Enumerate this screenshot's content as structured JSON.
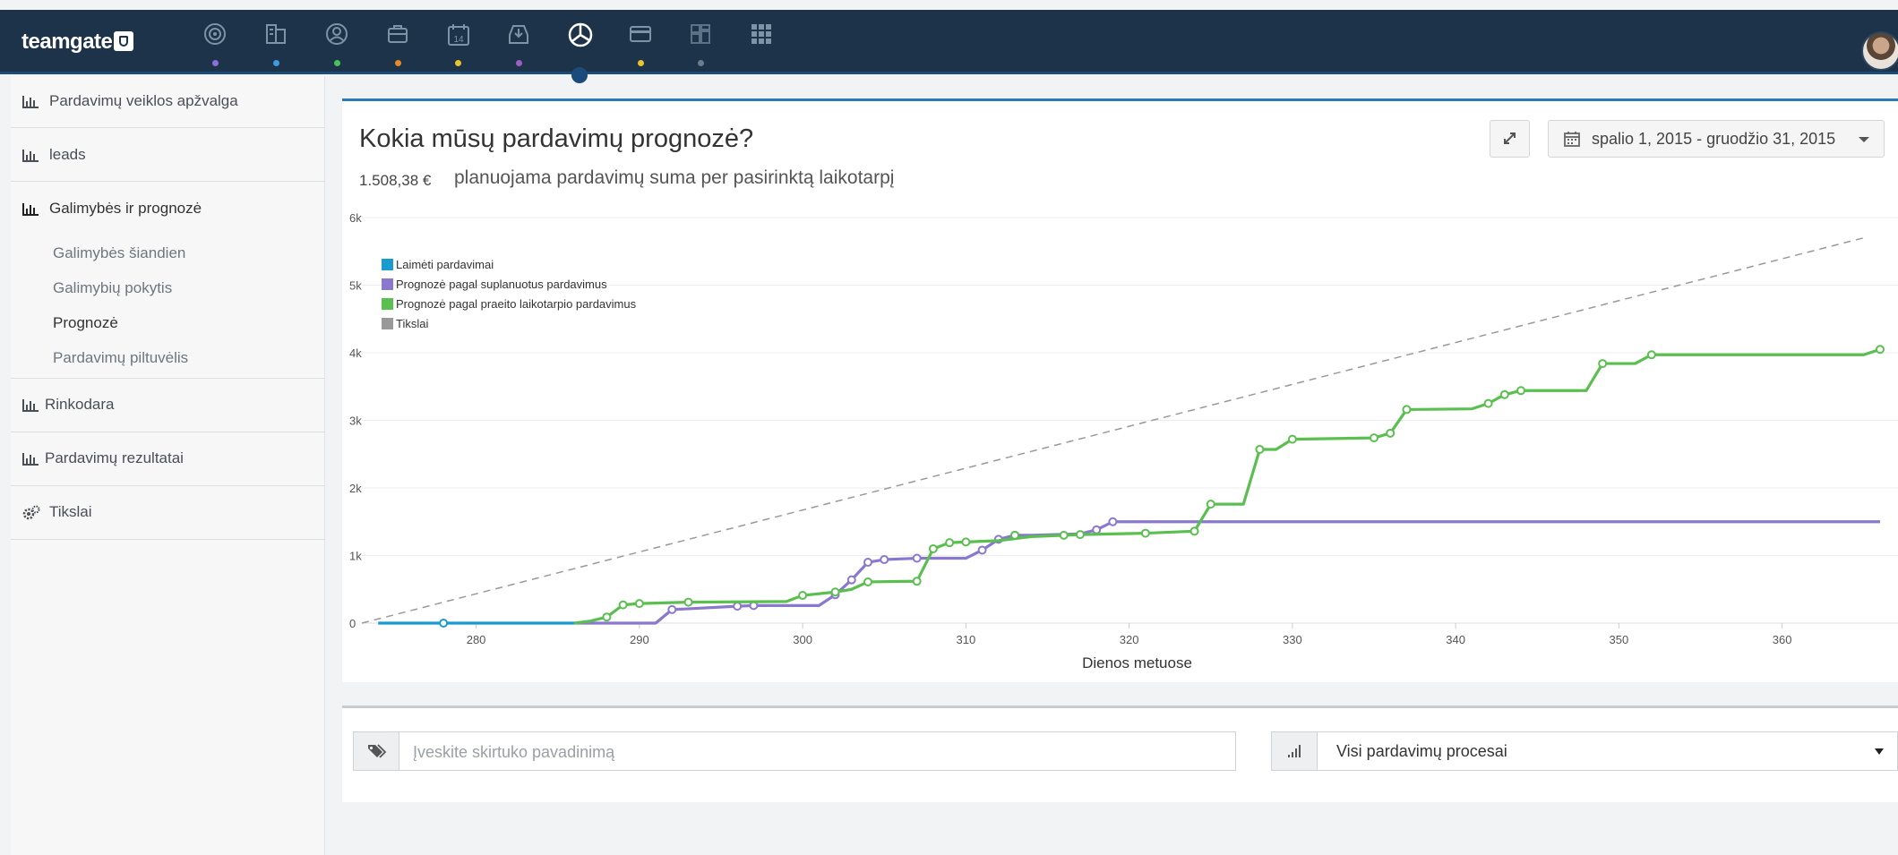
{
  "app": {
    "logo": "teamgate"
  },
  "nav": {
    "icons": [
      {
        "name": "target-icon",
        "dot_color": "#8b6fd6"
      },
      {
        "name": "building-icon",
        "dot_color": "#3d9be0"
      },
      {
        "name": "contacts-icon",
        "dot_color": "#4cc15a"
      },
      {
        "name": "briefcase-icon",
        "dot_color": "#e58a2c"
      },
      {
        "name": "calendar-icon",
        "dot_color": "#e8c32c"
      },
      {
        "name": "inbox-icon",
        "dot_color": "#9c5fc2"
      },
      {
        "name": "chart-pie-icon",
        "dot_color": "#1b4b7a"
      },
      {
        "name": "credit-card-icon",
        "dot_color": "#e8c32c"
      },
      {
        "name": "dashboard-icon",
        "dot_color": "#6b7c8c"
      },
      {
        "name": "apps-grid-icon",
        "dot_color": ""
      }
    ],
    "active_index": 6
  },
  "sidebar": {
    "sections": [
      {
        "label": "Pardavimų veiklos apžvalga"
      },
      {
        "label": "leads"
      },
      {
        "label": "Galimybės ir prognozė"
      },
      {
        "label": "Rinkodara"
      },
      {
        "label": "Pardavimų rezultatai"
      },
      {
        "label": "Tikslai"
      }
    ],
    "subitems": [
      {
        "label": "Galimybės šiandien"
      },
      {
        "label": "Galimybių pokytis"
      },
      {
        "label": "Prognozė"
      },
      {
        "label": "Pardavimų piltuvėlis"
      }
    ],
    "active_subitem": 2
  },
  "main": {
    "title": "Kokia mūsų pardavimų prognozė?",
    "sum_amount": "1.508,38 €",
    "sum_text": "planuojama pardavimų suma per pasirinktą laikotarpį",
    "date_range": "spalio 1, 2015 - gruodžio 31, 2015"
  },
  "filters": {
    "tab_placeholder": "Įveskite skirtuko pavadinimą",
    "process_select": "Visi pardavimų procesai"
  },
  "chart_data": {
    "type": "line",
    "xlabel": "Dienos metuose",
    "x_ticks": [
      280,
      290,
      300,
      310,
      320,
      330,
      340,
      350,
      360
    ],
    "y_ticks": [
      "0",
      "1k",
      "2k",
      "3k",
      "4k",
      "5k",
      "6k"
    ],
    "xlim": [
      273,
      366
    ],
    "ylim": [
      0,
      6000
    ],
    "legend_position": "top-left",
    "grid": true,
    "series": [
      {
        "name": "Laimėti pardavimai",
        "color": "#1a9bd0",
        "step": true,
        "points": [
          [
            274,
            0
          ],
          [
            278,
            0
          ],
          [
            286,
            0
          ]
        ],
        "markers": [
          [
            278,
            0
          ]
        ]
      },
      {
        "name": "Prognozė pagal suplanuotus pardavimus",
        "color": "#8a78cf",
        "step": true,
        "points": [
          [
            286,
            0
          ],
          [
            291,
            0
          ],
          [
            292,
            200
          ],
          [
            296,
            250
          ],
          [
            297,
            260
          ],
          [
            301,
            260
          ],
          [
            302,
            420
          ],
          [
            303,
            640
          ],
          [
            304,
            900
          ],
          [
            305,
            940
          ],
          [
            307,
            960
          ],
          [
            310,
            960
          ],
          [
            311,
            1080
          ],
          [
            312,
            1240
          ],
          [
            313,
            1300
          ],
          [
            314,
            1300
          ],
          [
            317,
            1320
          ],
          [
            318,
            1380
          ],
          [
            319,
            1500
          ],
          [
            366,
            1500
          ]
        ],
        "markers": [
          [
            292,
            200
          ],
          [
            296,
            250
          ],
          [
            297,
            260
          ],
          [
            302,
            420
          ],
          [
            303,
            640
          ],
          [
            304,
            900
          ],
          [
            305,
            940
          ],
          [
            307,
            960
          ],
          [
            311,
            1080
          ],
          [
            312,
            1240
          ],
          [
            313,
            1300
          ],
          [
            318,
            1380
          ],
          [
            319,
            1500
          ]
        ]
      },
      {
        "name": "Prognozė pagal praeito laikotarpio pardavimus",
        "color": "#5bbf50",
        "step": true,
        "points": [
          [
            286,
            0
          ],
          [
            287,
            30
          ],
          [
            288,
            90
          ],
          [
            289,
            270
          ],
          [
            290,
            290
          ],
          [
            293,
            310
          ],
          [
            299,
            320
          ],
          [
            300,
            410
          ],
          [
            302,
            460
          ],
          [
            303,
            500
          ],
          [
            304,
            610
          ],
          [
            307,
            620
          ],
          [
            308,
            1100
          ],
          [
            309,
            1190
          ],
          [
            310,
            1200
          ],
          [
            312,
            1220
          ],
          [
            314,
            1280
          ],
          [
            316,
            1300
          ],
          [
            317,
            1310
          ],
          [
            321,
            1330
          ],
          [
            324,
            1360
          ],
          [
            325,
            1760
          ],
          [
            327,
            1760
          ],
          [
            328,
            2570
          ],
          [
            329,
            2570
          ],
          [
            330,
            2720
          ],
          [
            335,
            2740
          ],
          [
            336,
            2810
          ],
          [
            337,
            3160
          ],
          [
            341,
            3170
          ],
          [
            342,
            3250
          ],
          [
            343,
            3380
          ],
          [
            344,
            3440
          ],
          [
            348,
            3440
          ],
          [
            349,
            3840
          ],
          [
            351,
            3840
          ],
          [
            352,
            3970
          ],
          [
            365,
            3970
          ],
          [
            366,
            4050
          ]
        ],
        "markers": [
          [
            288,
            90
          ],
          [
            289,
            270
          ],
          [
            290,
            290
          ],
          [
            293,
            310
          ],
          [
            300,
            410
          ],
          [
            302,
            460
          ],
          [
            304,
            610
          ],
          [
            307,
            620
          ],
          [
            308,
            1100
          ],
          [
            309,
            1190
          ],
          [
            310,
            1200
          ],
          [
            313,
            1300
          ],
          [
            316,
            1300
          ],
          [
            317,
            1310
          ],
          [
            321,
            1330
          ],
          [
            324,
            1360
          ],
          [
            325,
            1760
          ],
          [
            328,
            2570
          ],
          [
            330,
            2720
          ],
          [
            335,
            2740
          ],
          [
            336,
            2810
          ],
          [
            337,
            3160
          ],
          [
            342,
            3250
          ],
          [
            343,
            3380
          ],
          [
            344,
            3440
          ],
          [
            349,
            3840
          ],
          [
            352,
            3970
          ],
          [
            366,
            4050
          ]
        ]
      },
      {
        "name": "Tikslai",
        "color": "#999999",
        "dashed": true,
        "points": [
          [
            273,
            0
          ],
          [
            365,
            5700
          ]
        ],
        "markers": []
      }
    ]
  }
}
